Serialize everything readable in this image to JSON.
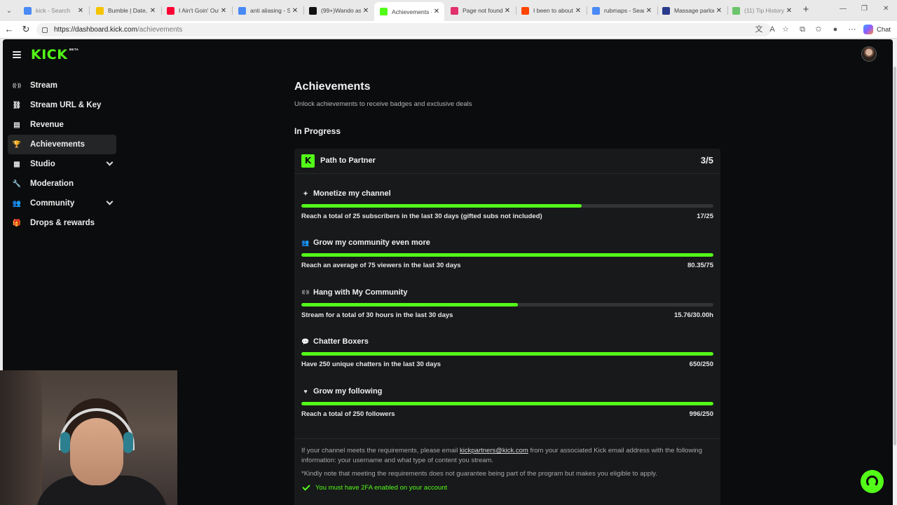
{
  "browser": {
    "tabs": [
      {
        "title": "kick - Search",
        "icon": "search-icon",
        "color": "#4a8af4",
        "dim": true
      },
      {
        "title": "Bumble | Date, Ch",
        "icon": "bumble-icon",
        "color": "#f5c400",
        "dim": false
      },
      {
        "title": "I Ain't Goin' Out L",
        "icon": "youtube-icon",
        "color": "#ff0033",
        "dim": false
      },
      {
        "title": "anti aliasing - Sea",
        "icon": "search-icon",
        "color": "#4a8af4",
        "dim": false
      },
      {
        "title": "(99+)Wando asce",
        "icon": "tiktok-icon",
        "color": "#111111",
        "dim": false
      },
      {
        "title": "Achievements - K",
        "icon": "kick-icon",
        "color": "#53fc18",
        "dim": false
      },
      {
        "title": "Page not found -",
        "icon": "instagram-icon",
        "color": "#e1306c",
        "dim": false
      },
      {
        "title": "I been to about 2",
        "icon": "reddit-icon",
        "color": "#ff4500",
        "dim": false
      },
      {
        "title": "rubmaps - Search",
        "icon": "search-icon",
        "color": "#4a8af4",
        "dim": false
      },
      {
        "title": "Massage parlor re",
        "icon": "news-icon",
        "color": "#2a3a8c",
        "dim": false
      },
      {
        "title": "(11) Tip History /",
        "icon": "tip-icon",
        "color": "#6cc46c",
        "dim": true
      }
    ],
    "active_tab": 5,
    "url_host": "https://dashboard.kick.com",
    "url_path": "/achievements",
    "chat_label": "Chat"
  },
  "app": {
    "brand": "KICK",
    "brand_tag": "BETA",
    "accent": "#53fc18"
  },
  "sidebar": {
    "items": [
      {
        "label": "Stream",
        "icon": "broadcast-icon",
        "glyph": "((·))",
        "active": false,
        "expand": false
      },
      {
        "label": "Stream URL & Key",
        "icon": "link-icon",
        "glyph": "⛓",
        "active": false,
        "expand": false
      },
      {
        "label": "Revenue",
        "icon": "chart-icon",
        "glyph": "▤",
        "active": false,
        "expand": false
      },
      {
        "label": "Achievements",
        "icon": "trophy-icon",
        "glyph": "🏆",
        "active": true,
        "expand": false
      },
      {
        "label": "Studio",
        "icon": "studio-icon",
        "glyph": "▦",
        "active": false,
        "expand": true
      },
      {
        "label": "Moderation",
        "icon": "wrench-icon",
        "glyph": "🔧",
        "active": false,
        "expand": false
      },
      {
        "label": "Community",
        "icon": "users-icon",
        "glyph": "👥",
        "active": false,
        "expand": true
      },
      {
        "label": "Drops & rewards",
        "icon": "gift-icon",
        "glyph": "🎁",
        "active": false,
        "expand": false
      }
    ]
  },
  "main": {
    "title": "Achievements",
    "subtitle": "Unlock achievements to receive badges and exclusive deals",
    "section": "In Progress",
    "card": {
      "title": "Path to Partner",
      "count": "3/5",
      "achievements": [
        {
          "title": "Monetize my channel",
          "icon": "sparkle-icon",
          "glyph": "✦",
          "desc": "Reach a total of 25 subscribers in the last 30 days (gifted subs not included)",
          "value": "17/25",
          "progress": 0.68
        },
        {
          "title": "Grow my community even more",
          "icon": "users-icon",
          "glyph": "👥",
          "desc": "Reach an average of 75 viewers in the last 30 days",
          "value": "80.35/75",
          "progress": 1.0
        },
        {
          "title": "Hang with My Community",
          "icon": "broadcast-icon",
          "glyph": "((·))",
          "desc": "Stream for a total of 30 hours in the last 30 days",
          "value": "15.76/30.00h",
          "progress": 0.525
        },
        {
          "title": "Chatter Boxers",
          "icon": "chat-bubble-icon",
          "glyph": "💬",
          "desc": "Have 250 unique chatters in the last 30 days",
          "value": "650/250",
          "progress": 1.0
        },
        {
          "title": "Grow my following",
          "icon": "heart-icon",
          "glyph": "♥",
          "desc": "Reach a total of 250 followers",
          "value": "996/250",
          "progress": 1.0
        }
      ],
      "note_pre": "If your channel meets the requirements, please email ",
      "note_email": "kickpartners@kick.com",
      "note_post": " from your associated Kick email address with the following information: your username and what type of content you stream.",
      "note2": "*Kindly note that meeting the requirements does not guarantee being part of the program but makes you eligible to apply.",
      "requirement": "You must have 2FA enabled on your account"
    }
  }
}
